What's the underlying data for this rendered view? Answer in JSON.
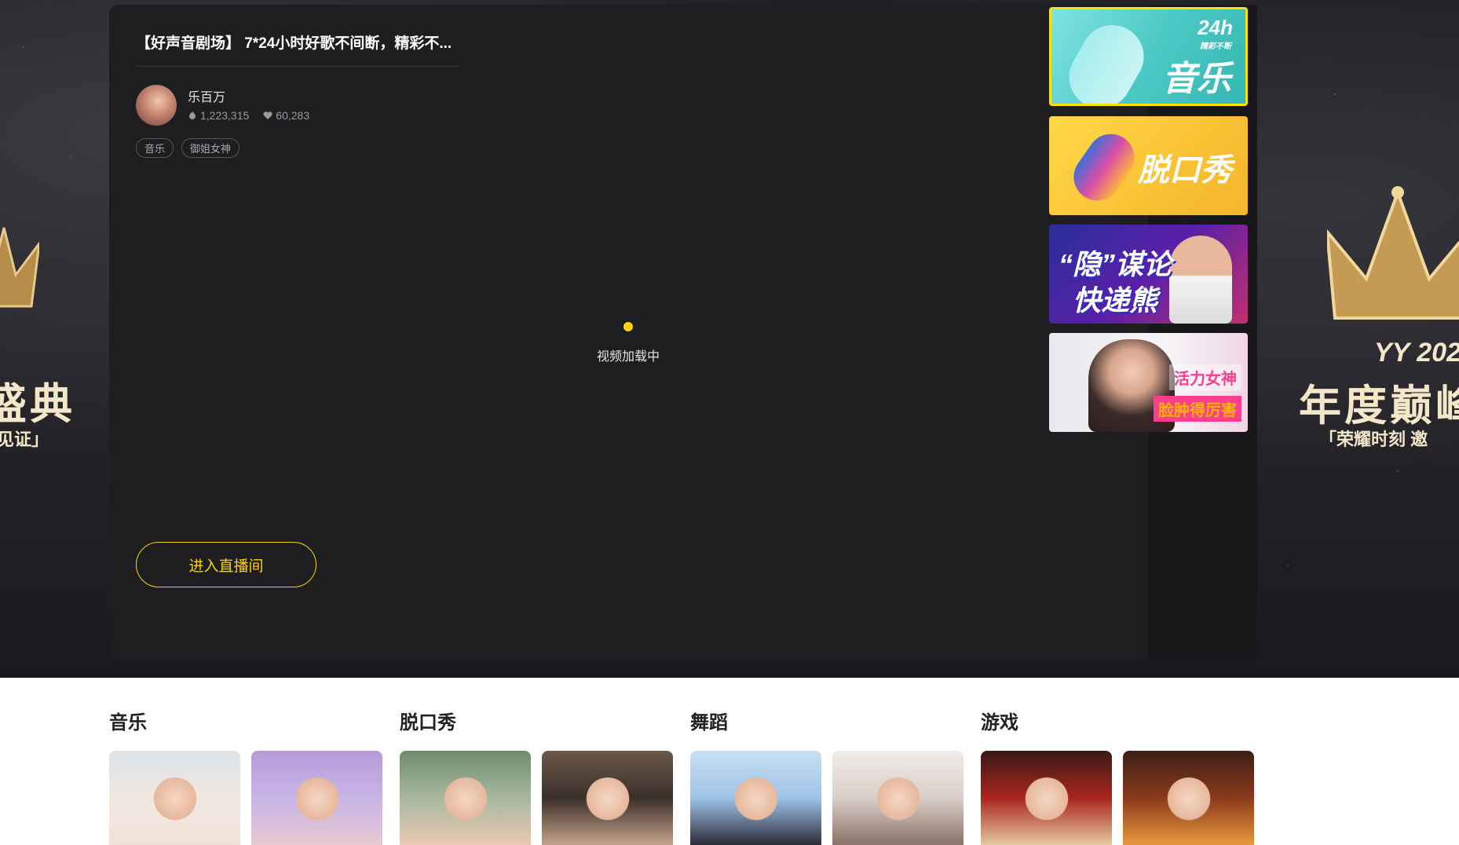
{
  "promo": {
    "left_big": "盛典",
    "left_small": "见证」",
    "right_tag": "YY 202",
    "right_big": "年度巅峰",
    "right_small": "「荣耀时刻 邀"
  },
  "player": {
    "title": "【好声音剧场】 7*24小时好歌不间断，精彩不...",
    "anchor_name": "乐百万",
    "hot_count": "1,223,315",
    "like_count": "60,283",
    "tags": [
      "音乐",
      "御姐女神"
    ],
    "loading_text": "视频加载中",
    "enter_button": "进入直播间"
  },
  "thumbnails": [
    {
      "text": "音乐",
      "badge": "24h",
      "sub": "精彩不断"
    },
    {
      "text": "脱口秀"
    },
    {
      "text1": "“隐”谋论",
      "text2": "快递熊"
    },
    {
      "text1": "活力女神",
      "text2": "脸肿得厉害"
    }
  ],
  "categories": [
    {
      "title": "音乐"
    },
    {
      "title": "脱口秀"
    },
    {
      "title": "舞蹈"
    },
    {
      "title": "游戏"
    }
  ],
  "colors": {
    "accent": "#ffd200",
    "panel": "#1e1e21",
    "active_border": "#ffe200"
  }
}
